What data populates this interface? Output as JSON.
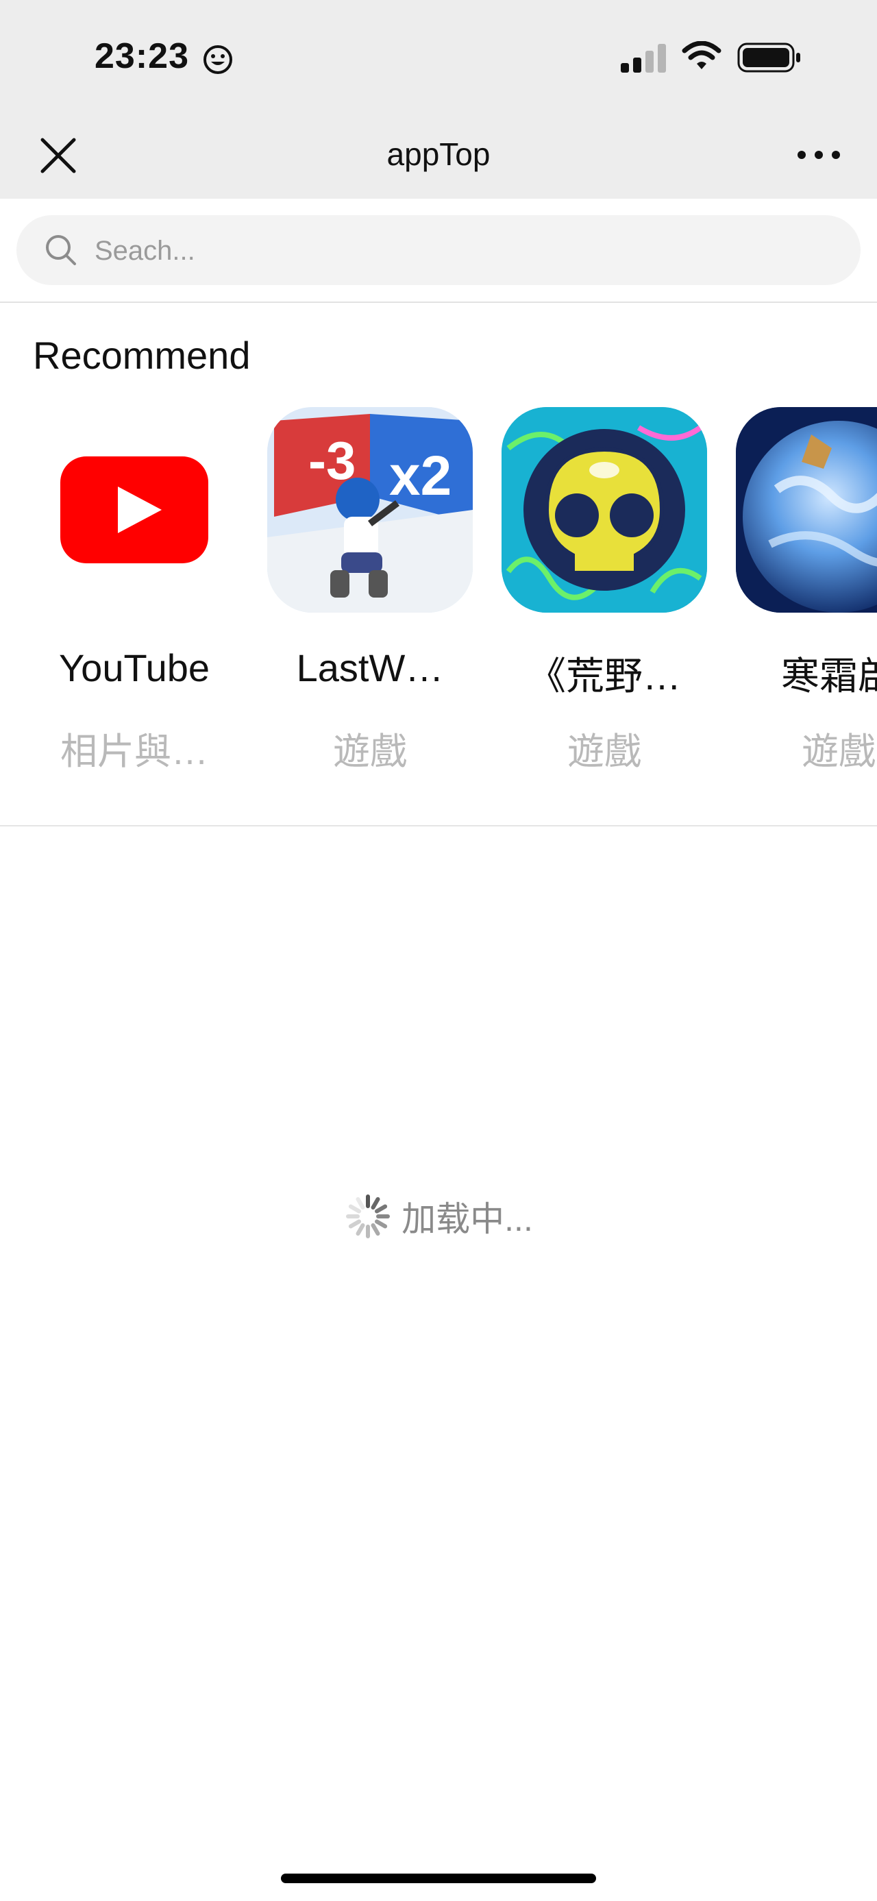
{
  "status_bar": {
    "time": "23:23",
    "icons": [
      "smiley-icon",
      "signal-icon",
      "wifi-icon",
      "battery-icon"
    ]
  },
  "nav": {
    "title": "appTop",
    "close_icon": "close-icon",
    "more_icon": "more-icon"
  },
  "search": {
    "placeholder": "Seach...",
    "value": ""
  },
  "recommend": {
    "title": "Recommend",
    "apps": [
      {
        "name": "YouTube",
        "category": "相片與…",
        "icon": "youtube-icon"
      },
      {
        "name": "LastW…",
        "category": "遊戲",
        "icon": "lastwar-icon"
      },
      {
        "name": "《荒野…",
        "category": "遊戲",
        "icon": "brawl-icon"
      },
      {
        "name": "寒霜啟",
        "category": "遊戲",
        "icon": "planet-icon"
      }
    ]
  },
  "loading": {
    "text": "加载中..."
  },
  "colors": {
    "header_bg": "#ededed",
    "youtube_red": "#ff0000",
    "muted_text": "#b9b9b9"
  }
}
